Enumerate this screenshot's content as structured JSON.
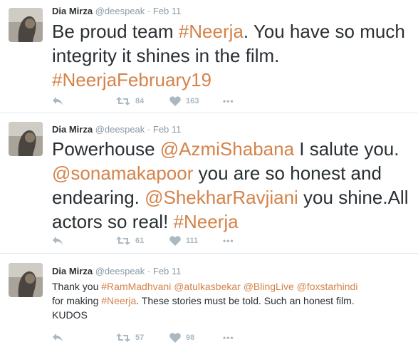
{
  "tweets": [
    {
      "name": "Dia Mirza",
      "handle": "@deespeak",
      "dot": "·",
      "date": "Feb 11",
      "retweets": "84",
      "likes": "163",
      "more": "•••",
      "lines": [
        [
          {
            "t": "Be proud team ",
            "tag": false
          },
          {
            "t": "#Neerja",
            "tag": true
          },
          {
            "t": ". You have so much",
            "tag": false
          }
        ],
        [
          {
            "t": "integrity it shines in the film.",
            "tag": false
          }
        ],
        [
          {
            "t": "#NeerjaFebruary19",
            "tag": true
          }
        ]
      ]
    },
    {
      "name": "Dia Mirza",
      "handle": "@deespeak",
      "dot": "·",
      "date": "Feb 11",
      "retweets": "61",
      "likes": "111",
      "more": "•••",
      "lines": [
        [
          {
            "t": "Powerhouse ",
            "tag": false
          },
          {
            "t": "@AzmiShabana",
            "tag": true
          },
          {
            "t": " I salute you.",
            "tag": false
          }
        ],
        [
          {
            "t": "@sonamakapoor",
            "tag": true
          },
          {
            "t": " you are so honest and",
            "tag": false
          }
        ],
        [
          {
            "t": "endearing. ",
            "tag": false
          },
          {
            "t": "@ShekharRavjiani",
            "tag": true
          },
          {
            "t": " you shine.All",
            "tag": false
          }
        ],
        [
          {
            "t": "actors so real! ",
            "tag": false
          },
          {
            "t": "#Neerja",
            "tag": true
          }
        ]
      ]
    },
    {
      "name": "Dia Mirza",
      "handle": "@deespeak",
      "dot": "·",
      "date": "Feb 11",
      "retweets": "57",
      "likes": "98",
      "more": "•••",
      "lines": [
        [
          {
            "t": "Thank you ",
            "tag": false
          },
          {
            "t": "#RamMadhvani",
            "tag": true
          },
          {
            "t": " ",
            "tag": false
          },
          {
            "t": "@atulkasbekar",
            "tag": true
          },
          {
            "t": " ",
            "tag": false
          },
          {
            "t": "@BlingLive",
            "tag": true
          },
          {
            "t": " ",
            "tag": false
          },
          {
            "t": "@foxstarhindi",
            "tag": true
          }
        ],
        [
          {
            "t": "for making ",
            "tag": false
          },
          {
            "t": "#Neerja",
            "tag": true
          },
          {
            "t": ". These stories must be told. Such an honest film.",
            "tag": false
          }
        ],
        [
          {
            "t": "KUDOS",
            "tag": false
          }
        ]
      ]
    }
  ],
  "colors": {
    "link": "#d4834a",
    "meta": "#8899a6",
    "icon": "#aab8c2",
    "separator": "#e1e8ed"
  },
  "icons": {
    "reply": "reply-icon",
    "retweet": "retweet-icon",
    "like": "heart-icon",
    "more": "more-icon"
  }
}
